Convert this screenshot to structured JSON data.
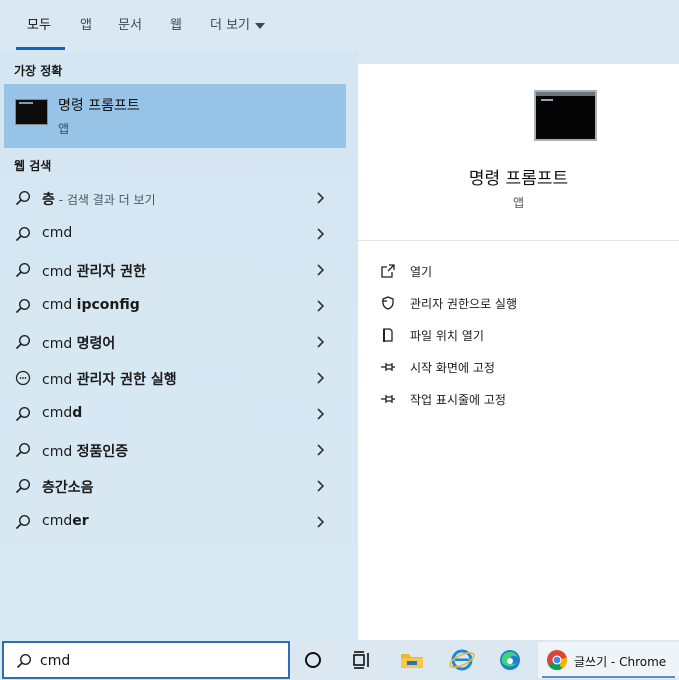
{
  "tabs": [
    {
      "label": "모두",
      "active": true
    },
    {
      "label": "앱",
      "active": false
    },
    {
      "label": "문서",
      "active": false
    },
    {
      "label": "웹",
      "active": false
    },
    {
      "label": "더 보기",
      "active": false
    }
  ],
  "best_match": {
    "section_label": "가장 정확",
    "title": "명령 프롬프트",
    "subtitle": "앱",
    "icon": "terminal-icon"
  },
  "web_search": {
    "section_label": "웹 검색",
    "results": [
      {
        "plain": "",
        "bold": "층",
        "dim": " - 검색 결과 더 보기",
        "icon": "search-icon"
      },
      {
        "plain": "cmd",
        "bold": "",
        "dim": "",
        "icon": "search-icon"
      },
      {
        "plain": "cmd ",
        "bold": "관리자 권한",
        "dim": "",
        "icon": "search-icon"
      },
      {
        "plain": "cmd ",
        "bold": "ipconfig",
        "dim": "",
        "icon": "search-icon"
      },
      {
        "plain": "cmd ",
        "bold": "명령어",
        "dim": "",
        "icon": "search-icon"
      },
      {
        "plain": "cmd ",
        "bold": "관리자 권한 실행",
        "dim": "",
        "icon": "chat-search-icon"
      },
      {
        "plain": "cmd",
        "bold": "d",
        "dim": "",
        "icon": "search-icon"
      },
      {
        "plain": "cmd ",
        "bold": "정품인증",
        "dim": "",
        "icon": "search-icon"
      },
      {
        "plain": "",
        "bold": "층간소음",
        "dim": "",
        "icon": "search-icon"
      },
      {
        "plain": "cmd",
        "bold": "er",
        "dim": "",
        "icon": "search-icon"
      }
    ]
  },
  "detail": {
    "title": "명령 프롬프트",
    "subtitle": "앱",
    "actions": [
      {
        "label": "열기",
        "icon": "open-icon"
      },
      {
        "label": "관리자 권한으로 실행",
        "icon": "shield-icon"
      },
      {
        "label": "파일 위치 열기",
        "icon": "file-location-icon"
      },
      {
        "label": "시작 화면에 고정",
        "icon": "pin-icon"
      },
      {
        "label": "작업 표시줄에 고정",
        "icon": "pin-icon"
      }
    ]
  },
  "taskbar": {
    "search_value": "cmd",
    "chrome_label": "글쓰기 - Chrome"
  },
  "colors": {
    "accent": "#0a66c2",
    "selected_row": "#97c3e6",
    "panel_bg": "#d9e8f2"
  }
}
